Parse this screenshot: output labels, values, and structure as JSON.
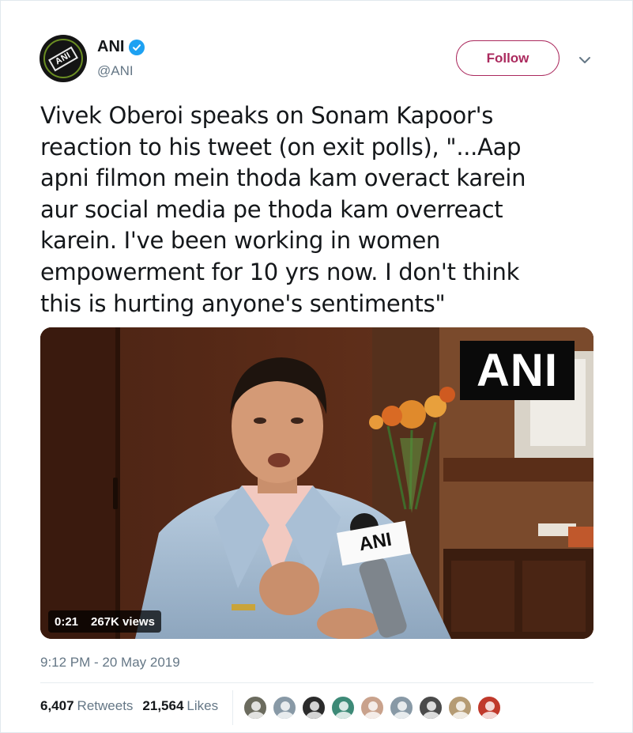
{
  "user": {
    "name": "ANI",
    "handle": "@ANI",
    "avatar_text": "ANI",
    "verified": true
  },
  "follow_label": "Follow",
  "tweet_lines": [
    "Vivek Oberoi speaks on Sonam Kapoor's",
    "reaction to his tweet (on exit polls), \"...Aap",
    "apni filmon mein thoda kam overact karein",
    "aur social media pe thoda kam overreact",
    "karein. I've been working in women",
    "empowerment for 10 yrs now. I don't think",
    "this is hurting anyone's sentiments\""
  ],
  "media": {
    "watermark": "ANI",
    "mic_label": "ANI",
    "duration": "0:21",
    "views": "267K views"
  },
  "timestamp": "9:12 PM - 20 May 2019",
  "stats": {
    "retweets_count": "6,407",
    "retweets_label": "Retweets",
    "likes_count": "21,564",
    "likes_label": "Likes"
  },
  "likers": [
    {
      "icon": "avatar-photo",
      "color": "#6b6b5e"
    },
    {
      "icon": "avatar-default",
      "color": "#8899a6"
    },
    {
      "icon": "avatar-wolf",
      "color": "#2b2b2b"
    },
    {
      "icon": "avatar-photo",
      "color": "#3d8a77"
    },
    {
      "icon": "avatar-photo",
      "color": "#c9a28c"
    },
    {
      "icon": "avatar-default",
      "color": "#8899a6"
    },
    {
      "icon": "avatar-photo",
      "color": "#4a4a4a"
    },
    {
      "icon": "avatar-photo",
      "color": "#b59b74"
    },
    {
      "icon": "avatar-photo",
      "color": "#c0392b"
    }
  ],
  "colors": {
    "follow_accent": "#ab2a5e",
    "verified_blue": "#1da1f2",
    "secondary_text": "#657786"
  }
}
